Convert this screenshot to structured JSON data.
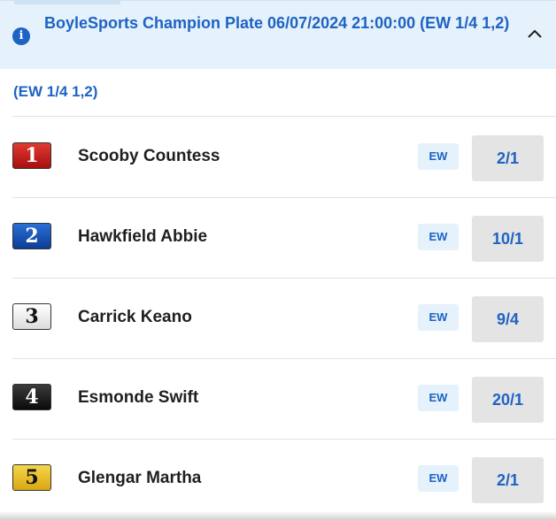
{
  "header": {
    "title": "BoyleSports Champion Plate 06/07/2024 21:00:00 (EW 1/4 1,2)",
    "info_icon": "info-icon",
    "collapse_icon": "chevron-up-icon"
  },
  "subheader": "(EW 1/4 1,2)",
  "runners": [
    {
      "number": "1",
      "silk_color": "#c4161c",
      "name": "Scooby Countess",
      "ew": "EW",
      "odds": "2/1"
    },
    {
      "number": "2",
      "silk_color": "#1a56b8",
      "name": "Hawkfield Abbie",
      "ew": "EW",
      "odds": "10/1"
    },
    {
      "number": "3",
      "silk_color": "#ffffff",
      "name": "Carrick Keano",
      "ew": "EW",
      "odds": "9/4"
    },
    {
      "number": "4",
      "silk_color": "#111111",
      "name": "Esmonde Swift",
      "ew": "EW",
      "odds": "20/1"
    },
    {
      "number": "5",
      "silk_color": "#f2c500",
      "name": "Glengar Martha",
      "ew": "EW",
      "odds": "2/1"
    }
  ],
  "colors": {
    "accent": "#1e63c4",
    "header_bg": "#e5f1fb",
    "odds_bg": "#e4e4e4"
  }
}
